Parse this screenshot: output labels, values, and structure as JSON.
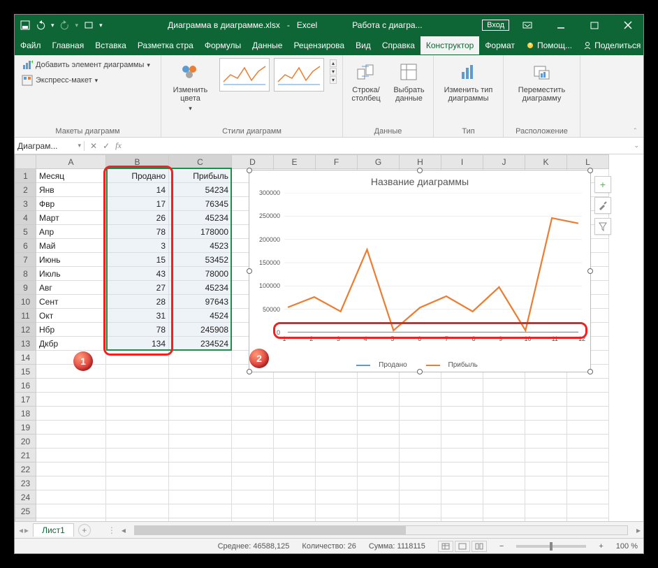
{
  "titlebar": {
    "file": "Диаграмма в диаграмме.xlsx",
    "app": "Excel",
    "context": "Работа с диагра...",
    "login": "Вход"
  },
  "menu": {
    "file": "Файл",
    "home": "Главная",
    "insert": "Вставка",
    "layout": "Разметка стра",
    "formulas": "Формулы",
    "data": "Данные",
    "review": "Рецензирова",
    "view": "Вид",
    "help": "Справка",
    "design": "Конструктор",
    "format": "Формат",
    "tell": "Помощ...",
    "share": "Поделиться"
  },
  "ribbon": {
    "group1": {
      "add_element": "Добавить элемент диаграммы",
      "quick_layout": "Экспресс-макет",
      "label": "Макеты диаграмм"
    },
    "group2": {
      "change_colors": "Изменить цвета",
      "label": "Стили диаграмм"
    },
    "group3": {
      "switch": "Строка/столбец",
      "select_data": "Выбрать данные",
      "label": "Данные"
    },
    "group4": {
      "change_type": "Изменить тип диаграммы",
      "label": "Тип"
    },
    "group5": {
      "move": "Переместить диаграмму",
      "label": "Расположение"
    }
  },
  "namebox": "Диаграм...",
  "columns": [
    "A",
    "B",
    "C",
    "D",
    "E",
    "F",
    "G",
    "H",
    "I",
    "J",
    "K",
    "L"
  ],
  "headers": {
    "a": "Месяц",
    "b": "Продано",
    "c": "Прибыль"
  },
  "rows": [
    {
      "n": 1,
      "a": "Месяц",
      "b": "Продано",
      "c": "Прибыль"
    },
    {
      "n": 2,
      "a": "Янв",
      "b": 14,
      "c": 54234
    },
    {
      "n": 3,
      "a": "Фвр",
      "b": 17,
      "c": 76345
    },
    {
      "n": 4,
      "a": "Март",
      "b": 26,
      "c": 45234
    },
    {
      "n": 5,
      "a": "Апр",
      "b": 78,
      "c": 178000
    },
    {
      "n": 6,
      "a": "Май",
      "b": 3,
      "c": 4523
    },
    {
      "n": 7,
      "a": "Июнь",
      "b": 15,
      "c": 53452
    },
    {
      "n": 8,
      "a": "Июль",
      "b": 43,
      "c": 78000
    },
    {
      "n": 9,
      "a": "Авг",
      "b": 27,
      "c": 45234
    },
    {
      "n": 10,
      "a": "Сент",
      "b": 28,
      "c": 97643
    },
    {
      "n": 11,
      "a": "Окт",
      "b": 31,
      "c": 4524
    },
    {
      "n": 12,
      "a": "Нбр",
      "b": 78,
      "c": 245908
    },
    {
      "n": 13,
      "a": "Дкбр",
      "b": 134,
      "c": 234524
    }
  ],
  "chart_data": {
    "type": "line",
    "title": "Название диаграммы",
    "x": [
      1,
      2,
      3,
      4,
      5,
      6,
      7,
      8,
      9,
      10,
      11,
      12
    ],
    "series": [
      {
        "name": "Продано",
        "color": "#5b9bd5",
        "values": [
          14,
          17,
          26,
          78,
          3,
          15,
          43,
          27,
          28,
          31,
          78,
          134
        ]
      },
      {
        "name": "Прибыль",
        "color": "#ed7d31",
        "values": [
          54234,
          76345,
          45234,
          178000,
          4523,
          53452,
          78000,
          45234,
          97643,
          4524,
          245908,
          234524
        ]
      }
    ],
    "ylim": [
      0,
      300000
    ],
    "yticks": [
      0,
      50000,
      100000,
      150000,
      200000,
      250000,
      300000
    ]
  },
  "sheet_tab": "Лист1",
  "statusbar": {
    "avg_label": "Среднее:",
    "avg_val": "46588,125",
    "count_label": "Количество:",
    "count_val": "26",
    "sum_label": "Сумма:",
    "sum_val": "1118115",
    "zoom": "100 %"
  },
  "callouts": {
    "one": "1",
    "two": "2"
  }
}
